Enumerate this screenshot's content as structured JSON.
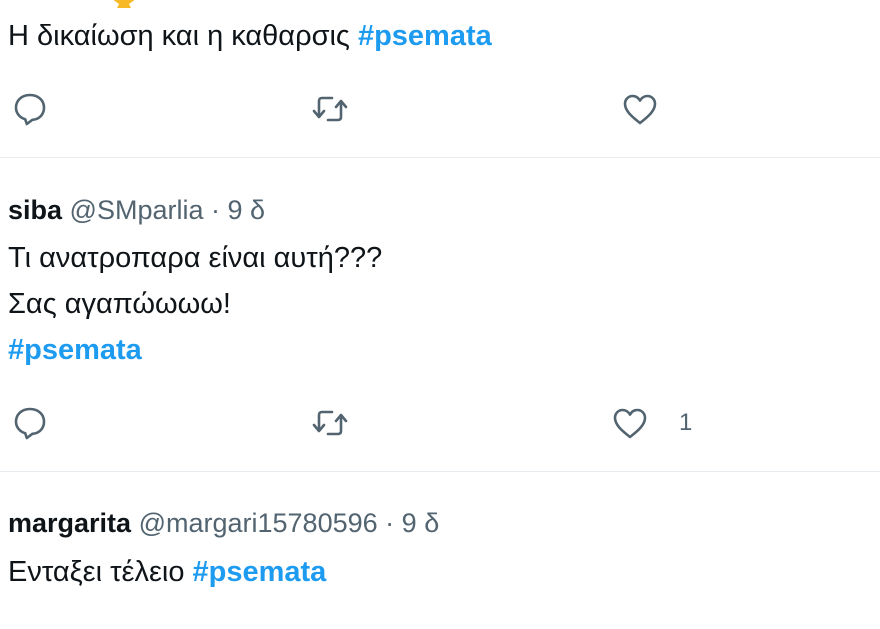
{
  "tweets": [
    {
      "text_before": "Η δικαίωση και η καθαρσις ",
      "hashtag": "#psemata",
      "actions": [
        "reply-icon",
        "retweet-icon",
        "like-icon"
      ]
    },
    {
      "name": "siba",
      "handle": "@SMparlia",
      "separator": "·",
      "time": "9 δ",
      "lines": [
        "Τι ανατροπαρα είναι αυτή???",
        "Σας αγαπώωωω!"
      ],
      "hashtag": "#psemata",
      "like_count": "1",
      "actions": [
        "reply-icon",
        "retweet-icon",
        "like-icon"
      ]
    },
    {
      "name": "margarita",
      "handle": "@margari15780596",
      "separator": "·",
      "time": "9 δ",
      "text_before": "Ενταξει τέλειο ",
      "hashtag": "#psemata"
    }
  ],
  "colors": {
    "hashtag": "#1d9bf0",
    "secondary_text": "#536471",
    "primary_text": "#0f1419",
    "divider": "#e6ecf0",
    "icon": "#536471"
  }
}
